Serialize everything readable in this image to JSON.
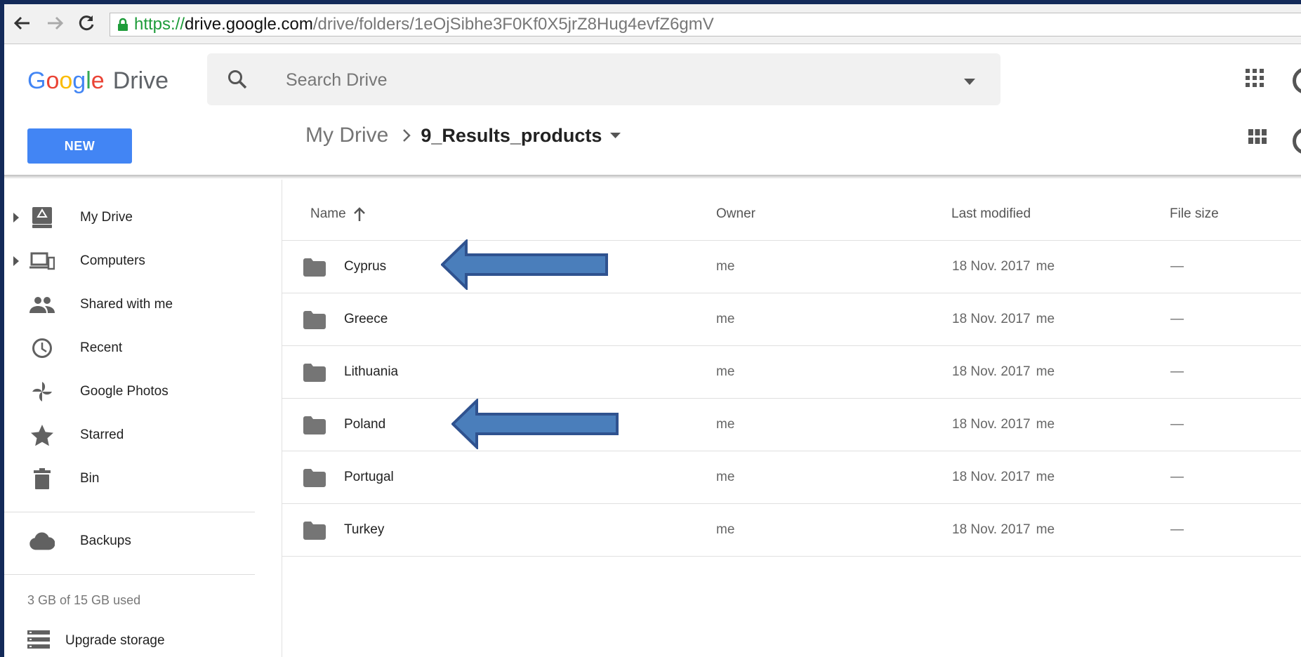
{
  "browser": {
    "url_scheme": "https://",
    "url_domain": "drive.google.com",
    "url_path": "/drive/folders/1eOjSibhe3F0Kf0X5jrZ8Hug4evfZ6gmV"
  },
  "header": {
    "logo_letters": [
      "G",
      "o",
      "o",
      "g",
      "l",
      "e"
    ],
    "logo_product": "Drive",
    "search_placeholder": "Search Drive"
  },
  "toolbar": {
    "new_label": "NEW",
    "breadcrumb_root": "My Drive",
    "breadcrumb_current": "9_Results_products"
  },
  "sidebar": {
    "items": [
      {
        "label": "My Drive",
        "icon": "drive-icon"
      },
      {
        "label": "Computers",
        "icon": "computers-icon"
      },
      {
        "label": "Shared with me",
        "icon": "people-icon"
      },
      {
        "label": "Recent",
        "icon": "clock-icon"
      },
      {
        "label": "Google Photos",
        "icon": "pinwheel-icon"
      },
      {
        "label": "Starred",
        "icon": "star-icon"
      },
      {
        "label": "Bin",
        "icon": "trash-icon"
      },
      {
        "label": "Backups",
        "icon": "cloud-icon"
      }
    ],
    "storage_text": "3 GB of 15 GB used",
    "upgrade_label": "Upgrade storage"
  },
  "table": {
    "columns": {
      "name": "Name",
      "owner": "Owner",
      "modified": "Last modified",
      "size": "File size"
    },
    "rows": [
      {
        "name": "Cyprus",
        "owner": "me",
        "modified": "18 Nov. 2017",
        "modified_by": "me",
        "size": "—"
      },
      {
        "name": "Greece",
        "owner": "me",
        "modified": "18 Nov. 2017",
        "modified_by": "me",
        "size": "—"
      },
      {
        "name": "Lithuania",
        "owner": "me",
        "modified": "18 Nov. 2017",
        "modified_by": "me",
        "size": "—"
      },
      {
        "name": "Poland",
        "owner": "me",
        "modified": "18 Nov. 2017",
        "modified_by": "me",
        "size": "—"
      },
      {
        "name": "Portugal",
        "owner": "me",
        "modified": "18 Nov. 2017",
        "modified_by": "me",
        "size": "—"
      },
      {
        "name": "Turkey",
        "owner": "me",
        "modified": "18 Nov. 2017",
        "modified_by": "me",
        "size": "—"
      }
    ]
  },
  "colors": {
    "accent": "#4285f4",
    "annotation_arrow": "#4a7ebb",
    "annotation_border": "#2f528f",
    "frame_background": "#132a59"
  }
}
